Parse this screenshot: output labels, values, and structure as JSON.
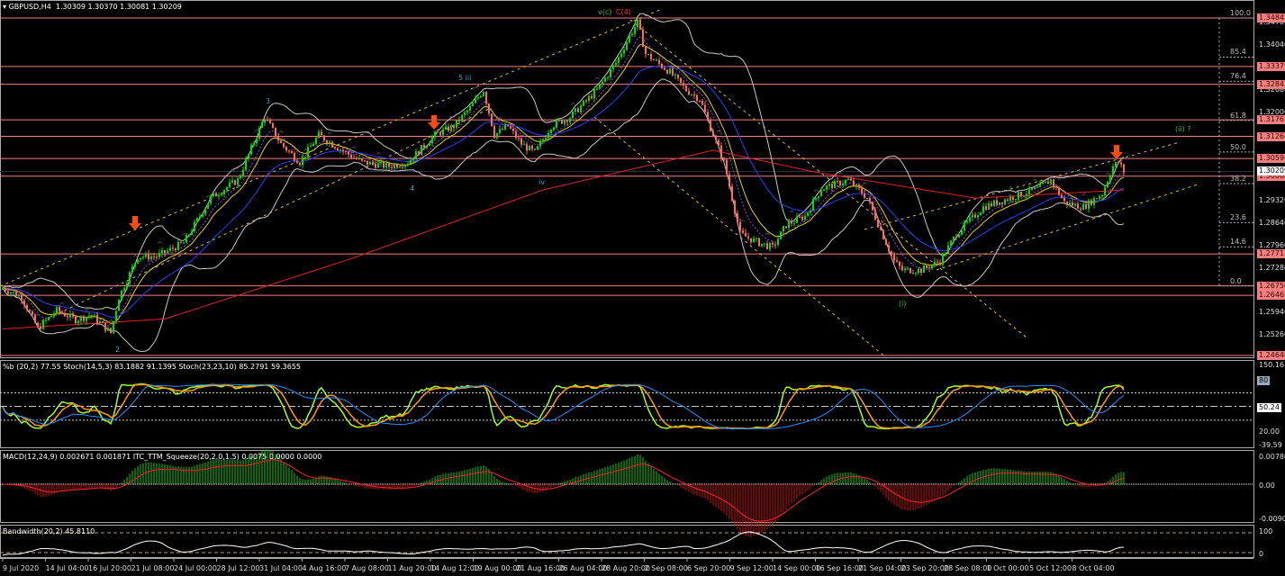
{
  "header": {
    "symbol": "GBPUSD,H4",
    "ohlc": "1.30309 1.30370 1.30081 1.30209"
  },
  "price_axis": {
    "levels": [
      "1.34845",
      "1.33379",
      "1.32843",
      "1.31767",
      "1.31268",
      "1.30598",
      "1.30066",
      "1.27717",
      "1.26750",
      "1.26465",
      "1.24646"
    ],
    "ticks": [
      "1.34700",
      "1.34040",
      "1.32680",
      "1.32000",
      "1.29320",
      "1.28640",
      "1.27960",
      "1.27280",
      "1.25940",
      "1.25260"
    ],
    "current": "1.30209"
  },
  "fibo": {
    "labels": [
      "100.0",
      "85.4",
      "76.4",
      "61.8",
      "50.0",
      "38.2",
      "23.6",
      "14.6",
      "0.0"
    ],
    "values": [
      100,
      85.4,
      76.4,
      61.8,
      50,
      38.2,
      23.6,
      14.6,
      0
    ],
    "high": 1.34845,
    "low": 1.2675
  },
  "wave_labels": {
    "vc": "v(c)",
    "c4": "C(4)",
    "w3": "3",
    "w5iii": "5 iii",
    "w4": "4",
    "wiv": "iv",
    "w2": "2",
    "wi": "(i)",
    "wii": "(ii) ?"
  },
  "stoch_panel": {
    "title": "%b (20,2) 77.55  Stoch(14,5,3) 83.1882 91.1395  Stoch(23,23,10) 85.2791 59.3655",
    "ticks": [
      "150.16",
      "80",
      "50.24",
      "20.00",
      "-39.59"
    ]
  },
  "macd_panel": {
    "title": "MACD(12,24,9) 0.002671 0.001871  ITC_TTM_Squeeze(20,2.0,1.5) 0.0075 0.0000 0.0000",
    "ticks": [
      "0.007804",
      "0.00",
      "-0.009012"
    ]
  },
  "bw_panel": {
    "title": "Bandwidth(20,2) 45.8110",
    "ticks": [
      "100",
      "0"
    ]
  },
  "time_axis": [
    "9 Jul 2020",
    "14 Jul 04:00",
    "16 Jul 20:00",
    "21 Jul 08:00",
    "24 Jul 00:00",
    "28 Jul 12:00",
    "31 Jul 04:00",
    "4 Aug 16:00",
    "7 Aug 08:00",
    "11 Aug 20:00",
    "14 Aug 12:00",
    "19 Aug 00:00",
    "21 Aug 16:00",
    "26 Aug 04:00",
    "28 Aug 20:00",
    "2 Sep 08:00",
    "6 Sep 20:00",
    "9 Sep 12:00",
    "14 Sep 00:00",
    "16 Sep 16:00",
    "21 Sep 04:00",
    "23 Sep 20:00",
    "28 Sep 08:00",
    "1 Oct 00:00",
    "5 Oct 12:00",
    "8 Oct 04:00"
  ],
  "colors": {
    "bull": "#00e000",
    "bear": "#ff6a5a",
    "level": "#f08080",
    "ma_fast": "#e8d000",
    "ma_mid": "#2040ff",
    "ma_slow": "#e02020",
    "bands": "#c8c8c8",
    "trend": "#e0c000",
    "arrow": "#ff4a10",
    "wave_green": "#20c040",
    "wave_blue": "#40a0c0"
  },
  "chart_data": {
    "type": "candlestick",
    "symbol": "GBPUSD",
    "timeframe": "H4",
    "ylim": [
      1.24646,
      1.3494
    ],
    "close_keypoints": {
      "bar": [
        0,
        7,
        13,
        20,
        27,
        33,
        40,
        43,
        50,
        57,
        67,
        77,
        87,
        97,
        103,
        110,
        117,
        127,
        133,
        143,
        150,
        160,
        167,
        173,
        178,
        182,
        187,
        192,
        197,
        203,
        210,
        220,
        227,
        232,
        235,
        238,
        247,
        253,
        258,
        263,
        267,
        273,
        280,
        285,
        290,
        297,
        303,
        313,
        320,
        327,
        330,
        333,
        340,
        347,
        353,
        363,
        373,
        383,
        388,
        393,
        400,
        407,
        411,
        413,
        415
      ],
      "price": [
        1.2669,
        1.2641,
        1.2546,
        1.2601,
        1.2573,
        1.2587,
        1.2533,
        1.2641,
        1.2764,
        1.2764,
        1.2805,
        1.2941,
        1.2995,
        1.3185,
        1.3104,
        1.3049,
        1.3131,
        1.3077,
        1.3049,
        1.3036,
        1.3049,
        1.3131,
        1.3158,
        1.3213,
        1.3267,
        1.3131,
        1.3158,
        1.3104,
        1.3077,
        1.3158,
        1.3185,
        1.3267,
        1.3349,
        1.343,
        1.3471,
        1.3376,
        1.3321,
        1.3267,
        1.324,
        1.3131,
        1.3049,
        1.2832,
        1.2805,
        1.2791,
        1.2859,
        1.2886,
        1.2968,
        1.2995,
        1.2941,
        1.2805,
        1.275,
        1.2723,
        1.2723,
        1.275,
        1.2832,
        1.2913,
        1.2941,
        1.2968,
        1.2995,
        1.2927,
        1.2913,
        1.2954,
        1.3036,
        1.3049,
        1.3021
      ]
    },
    "ma200_keypoints": {
      "bar": [
        0,
        60,
        130,
        200,
        263,
        300,
        360,
        415
      ],
      "price": [
        1.2545,
        1.2575,
        1.276,
        1.2965,
        1.3085,
        1.302,
        1.294,
        1.2965
      ]
    }
  }
}
